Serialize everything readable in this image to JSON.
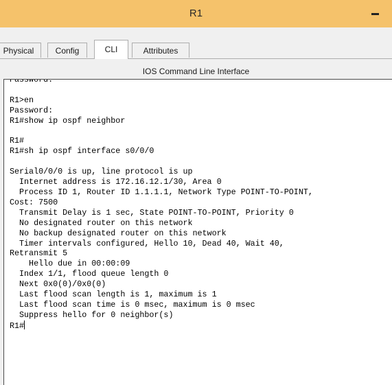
{
  "window": {
    "title": "R1"
  },
  "tabs": [
    {
      "label": "Physical",
      "active": false
    },
    {
      "label": "Config",
      "active": false
    },
    {
      "label": "CLI",
      "active": true
    },
    {
      "label": "Attributes",
      "active": false
    }
  ],
  "cli": {
    "header": "IOS Command Line Interface",
    "output_lines": [
      "Password:",
      "",
      "R1>en",
      "Password:",
      "R1#show ip ospf neighbor",
      "",
      "R1#",
      "R1#sh ip ospf interface s0/0/0",
      "",
      "Serial0/0/0 is up, line protocol is up",
      "  Internet address is 172.16.12.1/30, Area 0",
      "  Process ID 1, Router ID 1.1.1.1, Network Type POINT-TO-POINT,",
      "Cost: 7500",
      "  Transmit Delay is 1 sec, State POINT-TO-POINT, Priority 0",
      "  No designated router on this network",
      "  No backup designated router on this network",
      "  Timer intervals configured, Hello 10, Dead 40, Wait 40,",
      "Retransmit 5",
      "    Hello due in 00:00:09",
      "  Index 1/1, flood queue length 0",
      "  Next 0x0(0)/0x0(0)",
      "  Last flood scan length is 1, maximum is 1",
      "  Last flood scan time is 0 msec, maximum is 0 msec",
      "  Suppress hello for 0 neighbor(s)"
    ],
    "prompt": "R1#"
  }
}
